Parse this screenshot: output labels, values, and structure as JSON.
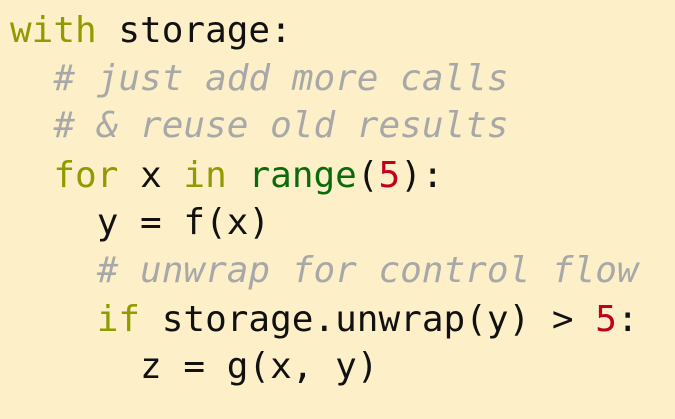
{
  "code": {
    "lines": [
      {
        "indent": "",
        "parts": [
          "with",
          " storage:"
        ]
      },
      {
        "indent": "  ",
        "parts": [
          "# just add more calls"
        ]
      },
      {
        "indent": "  ",
        "parts": [
          "# & reuse old results"
        ]
      },
      {
        "indent": "  ",
        "parts": [
          "for",
          " x ",
          "in",
          " ",
          "range",
          "(",
          "5",
          "):"
        ]
      },
      {
        "indent": "    ",
        "parts": [
          "y = f(x)"
        ]
      },
      {
        "indent": "    ",
        "parts": [
          "# unwrap for control flow"
        ]
      },
      {
        "indent": "    ",
        "parts": [
          "if",
          " storage.unwrap(y) > ",
          "5",
          ":"
        ]
      },
      {
        "indent": "      ",
        "parts": [
          "z = g(x, y)"
        ]
      }
    ]
  },
  "colors": {
    "background": "#fdf0c9",
    "keyword": "#8f9b00",
    "builtin": "#0b6b0b",
    "number": "#c1001f",
    "comment": "#a8a8a8",
    "text": "#111111"
  }
}
